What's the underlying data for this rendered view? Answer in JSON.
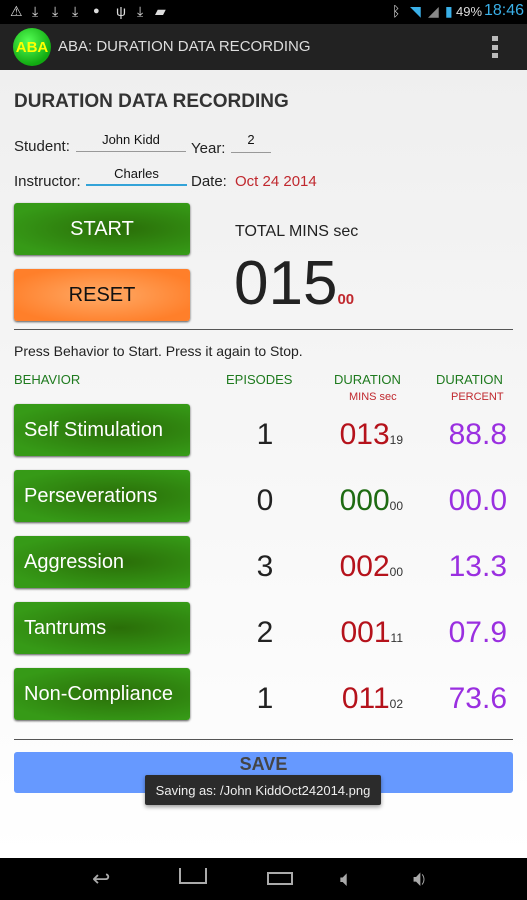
{
  "status_bar": {
    "battery": "49%",
    "time": "18:46"
  },
  "app_bar": {
    "logo_text": "ABA",
    "title": "ABA: DURATION DATA RECORDING"
  },
  "page": {
    "title": "DURATION DATA RECORDING",
    "student_label": "Student:",
    "student_value": "John Kidd",
    "year_label": "Year:",
    "year_value": "2",
    "instructor_label": "Instructor:",
    "instructor_value": "Charles",
    "date_label": "Date:",
    "date_value": "Oct 24 2014"
  },
  "controls": {
    "start_label": "START",
    "reset_label": "RESET",
    "total_label": "TOTAL MINS sec",
    "total_main": "015",
    "total_sec": "00"
  },
  "instruction": "Press Behavior to Start. Press it again to Stop.",
  "table": {
    "headers": {
      "behavior": "BEHAVIOR",
      "episodes": "EPISODES",
      "duration": "DURATION",
      "duration_sub": "MINS sec",
      "percent": "DURATION",
      "percent_sub": "PERCENT"
    },
    "rows": [
      {
        "behavior": "Self Stimulation",
        "episodes": "1",
        "mins": "013",
        "sec": "19",
        "percent": "88.8",
        "color": "#b5121b"
      },
      {
        "behavior": "Perseverations",
        "episodes": "0",
        "mins": "000",
        "sec": "00",
        "percent": "00.0",
        "color": "#1e6b12"
      },
      {
        "behavior": "Aggression",
        "episodes": "3",
        "mins": "002",
        "sec": "00",
        "percent": "13.3",
        "color": "#b5121b"
      },
      {
        "behavior": "Tantrums",
        "episodes": "2",
        "mins": "001",
        "sec": "11",
        "percent": "07.9",
        "color": "#b5121b"
      },
      {
        "behavior": "Non-Compliance",
        "episodes": "1",
        "mins": "011",
        "sec": "02",
        "percent": "73.6",
        "color": "#b5121b"
      }
    ]
  },
  "save_label": "SAVE",
  "toast": "Saving as: /John KiddOct242014.png"
}
